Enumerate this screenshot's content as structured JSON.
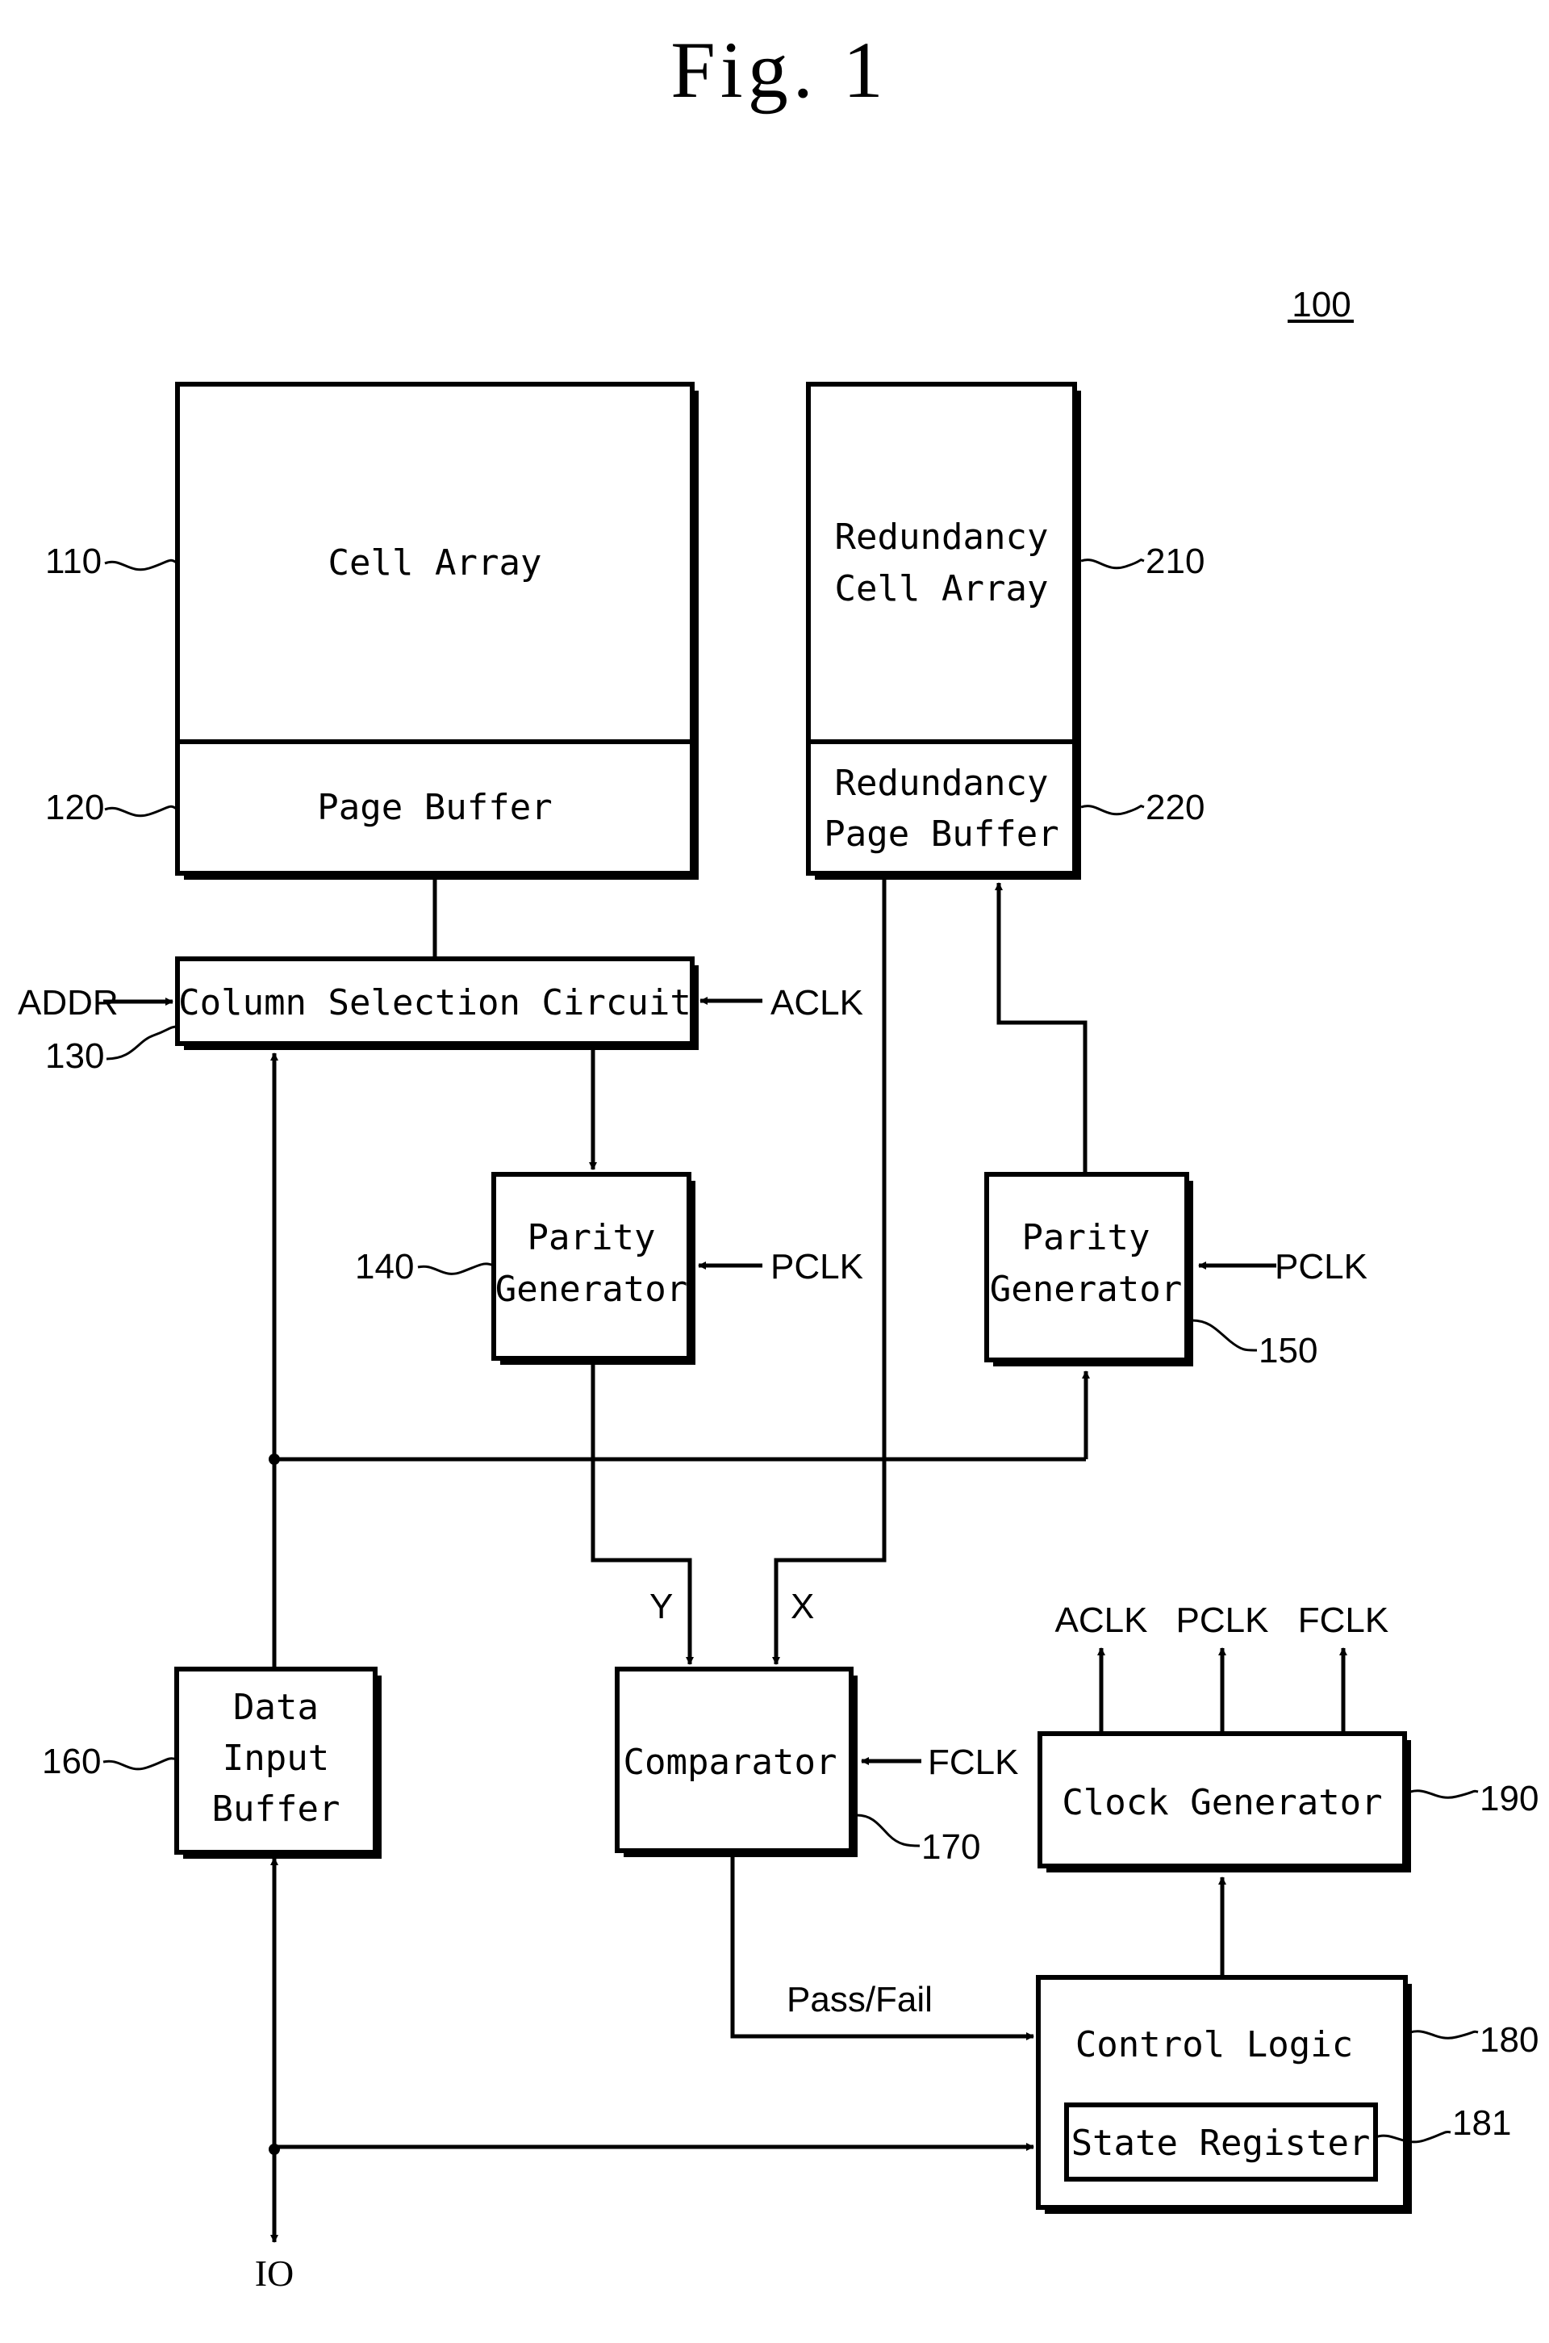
{
  "figure": {
    "title": "Fig. 1",
    "reference": "100"
  },
  "blocks": {
    "cell_array": {
      "label": "Cell Array",
      "ref": "110"
    },
    "page_buffer": {
      "label": "Page Buffer",
      "ref": "120"
    },
    "redundancy_cell_array": {
      "label_line1": "Redundancy",
      "label_line2": "Cell Array",
      "ref": "210"
    },
    "redundancy_page_buffer": {
      "label_line1": "Redundancy",
      "label_line2": "Page Buffer",
      "ref": "220"
    },
    "column_selection": {
      "label": "Column Selection Circuit",
      "ref": "130"
    },
    "parity_gen_main": {
      "label_line1": "Parity",
      "label_line2": "Generator",
      "ref": "140"
    },
    "parity_gen_redundancy": {
      "label_line1": "Parity",
      "label_line2": "Generator",
      "ref": "150"
    },
    "data_input_buffer": {
      "label_line1": "Data",
      "label_line2": "Input",
      "label_line3": "Buffer",
      "ref": "160"
    },
    "comparator": {
      "label": "Comparator",
      "ref": "170"
    },
    "control_logic": {
      "label": "Control Logic",
      "ref": "180"
    },
    "state_register": {
      "label": "State Register",
      "ref": "181"
    },
    "clock_generator": {
      "label": "Clock Generator",
      "ref": "190"
    }
  },
  "signals": {
    "addr": "ADDR",
    "aclk_in": "ACLK",
    "pclk_main": "PCLK",
    "pclk_red": "PCLK",
    "fclk_in": "FCLK",
    "y": "Y",
    "x": "X",
    "pass_fail": "Pass/Fail",
    "io": "IO",
    "clk_out_aclk": "ACLK",
    "clk_out_pclk": "PCLK",
    "clk_out_fclk": "FCLK"
  }
}
